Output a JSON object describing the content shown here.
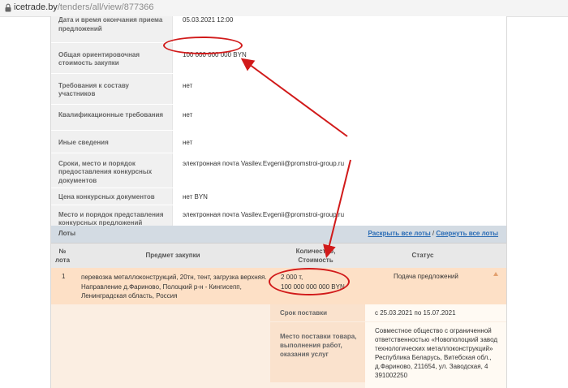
{
  "browser": {
    "url_host": "icetrade.by",
    "url_path": "/tenders/all/view/877366"
  },
  "info_rows": [
    {
      "label": "Дата и время окончания приема предложений",
      "value": "05.03.2021 12:00"
    },
    {
      "label": "Общая ориентировочная стоимость закупки",
      "value": "100 000 000 000 BYN"
    },
    {
      "label": "Требования к составу участников",
      "value": "нет"
    },
    {
      "label": "Квалификационные требования",
      "value": "нет"
    },
    {
      "label": "Иные сведения",
      "value": "нет"
    },
    {
      "label": "Сроки, место и порядок предоставления конкурсных документов",
      "value": "электронная почта Vasilev.Evgenii@promstroi-group.ru"
    },
    {
      "label": "Цена конкурсных документов",
      "value": "нет BYN"
    },
    {
      "label": "Место и порядок представления конкурсных предложений",
      "value": "электронная почта Vasilev.Evgenii@promstroi-group.ru"
    }
  ],
  "lots": {
    "title": "Лоты",
    "expand_all": "Раскрыть все лоты",
    "separator": " / ",
    "collapse_all": "Свернуть все лоты",
    "columns": {
      "num": "№ лота",
      "subject": "Предмет закупки",
      "qty": "Количество, Стоимость",
      "status": "Статус"
    },
    "row": {
      "num": "1",
      "subject": "перевозка металлоконструкций, 20тн, тент, загрузка верхняя. Направление д.Фариново, Полоцкий р-н - Кингисепп, Ленинградская область, Россия",
      "qty_line1": "2 000 т,",
      "qty_line2": "100 000 000 000 BYN",
      "status": "Подача предложений"
    },
    "details": [
      {
        "label": "Срок поставки",
        "value": "с 25.03.2021 по 15.07.2021"
      },
      {
        "label": "Место поставки товара, выполнения работ, оказания услуг",
        "value": "Совместное общество с ограниченной ответственностью «Новополоцкий завод технологических металлоконструкций» Республика Беларусь, Витебская обл., д.Фариново, 211654, ул. Заводская, 4 391002250"
      }
    ]
  },
  "colors": {
    "annotation": "#d11a1a",
    "lot_row_bg": "#fde0c6",
    "link": "#2a6cb5"
  }
}
